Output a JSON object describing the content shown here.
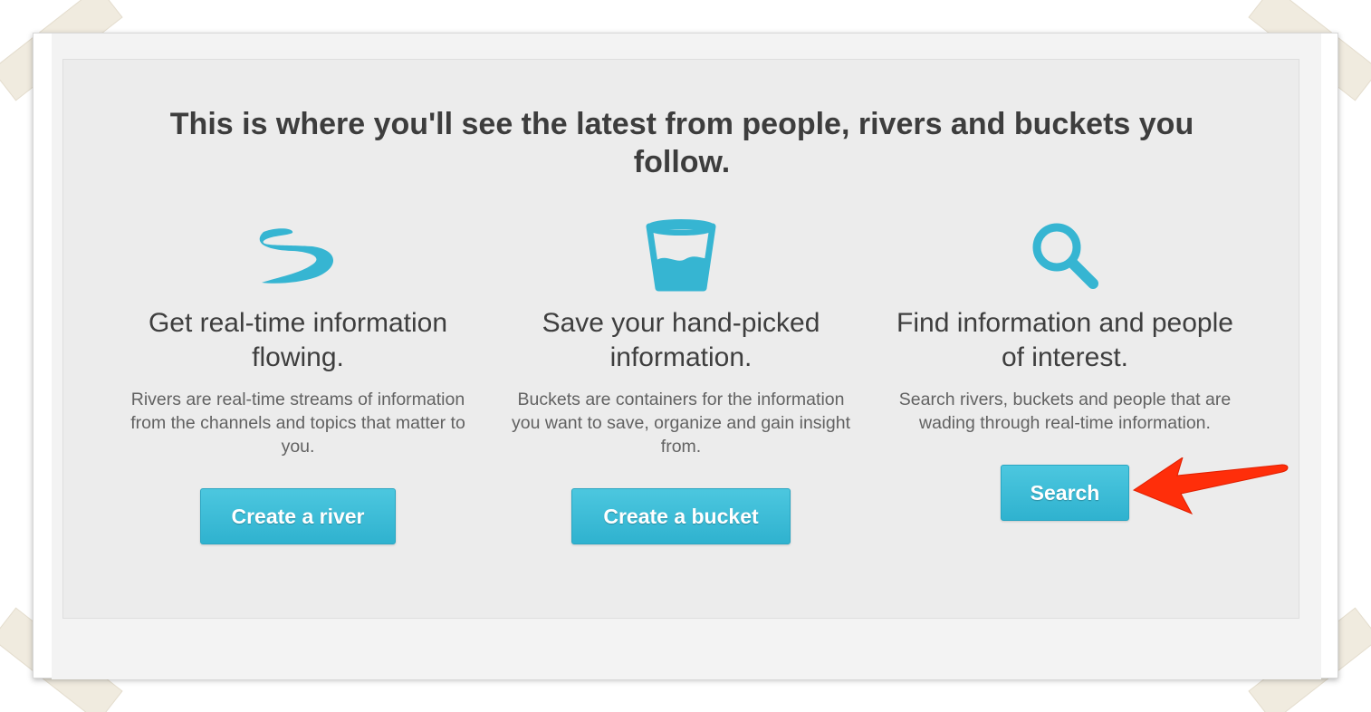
{
  "headline": "This is where you'll see the latest from people, rivers and buckets you follow.",
  "columns": [
    {
      "icon": "river-icon",
      "title": "Get real-time information flowing.",
      "description": "Rivers are real-time streams of information from the channels and topics that matter to you.",
      "button_label": "Create a river"
    },
    {
      "icon": "bucket-icon",
      "title": "Save your hand-picked information.",
      "description": "Buckets are containers for the information you want to save, organize and gain insight from.",
      "button_label": "Create a bucket"
    },
    {
      "icon": "search-icon",
      "title": "Find information and people of interest.",
      "description": "Search rivers, buckets and people that are wading through real-time information.",
      "button_label": "Search"
    }
  ],
  "colors": {
    "accent": "#37b9d4",
    "panel": "#ececec",
    "annotation_arrow": "#ff2e0a"
  }
}
